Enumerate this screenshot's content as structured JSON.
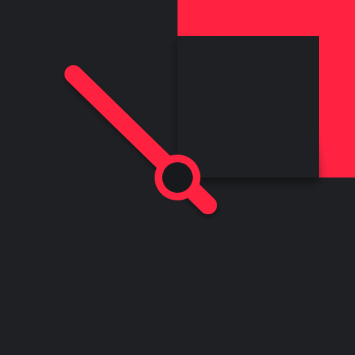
{
  "app_icon": {
    "icon": "clock-icon",
    "colors": {
      "background": "#1f2024",
      "accent": "#ff2341",
      "minute_hand": "#a0a0a0",
      "center_dot": "#18191c"
    }
  }
}
